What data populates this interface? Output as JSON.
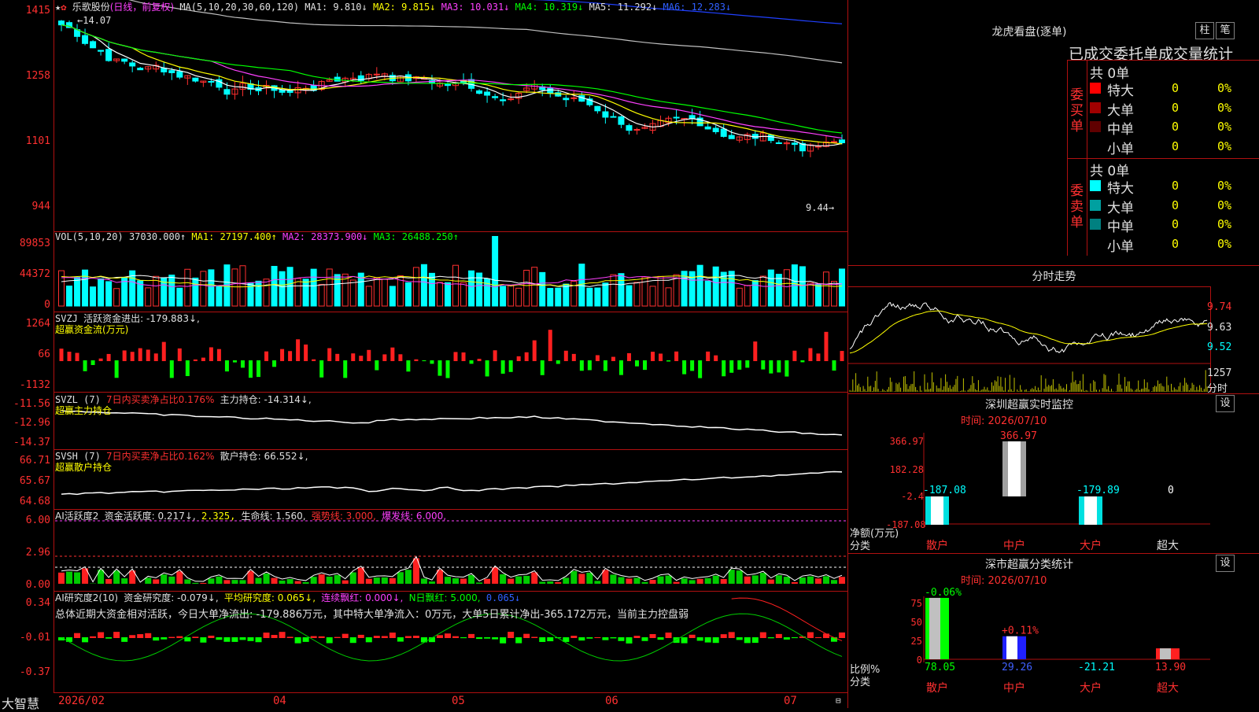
{
  "stock": {
    "name": "乐歌股份",
    "period_label": "(日线，前复权)",
    "ma_header": "MA(5,10,20,30,60,120)",
    "ma1": "MA1: 9.810↓",
    "ma2": "MA2: 9.815↓",
    "ma3": "MA3: 10.031↓",
    "ma4": "MA4: 10.319↓",
    "ma5": "MA5: 11.292↓",
    "ma6": "MA6: 12.283↓",
    "high_label": "14.07",
    "low_label": "9.44→",
    "y_ticks": [
      "1415",
      "1258",
      "1101",
      "944"
    ]
  },
  "vol": {
    "header": "VOL(5,10,20)",
    "value": "37030.000↑",
    "ma1": "MA1: 27197.400↑",
    "ma2": "MA2: 28373.900↓",
    "ma3": "MA3: 26488.250↑",
    "y_ticks": [
      "89853",
      "44372",
      "0"
    ]
  },
  "svzj": {
    "header": "SVZJ",
    "active": "活跃资金进出: -179.883↓,",
    "sub": "超赢资金流(万元)",
    "y_ticks": [
      "1264",
      "66",
      "-1132"
    ]
  },
  "svzl": {
    "header": "SVZL (7)",
    "ratio": "7日内买卖净占比0.176%",
    "pos": "主力持仓: -14.314↓,",
    "sub": "超赢主力持仓",
    "y_ticks": [
      "-11.56",
      "-12.96",
      "-14.37"
    ]
  },
  "svsh": {
    "header": "SVSH (7)",
    "ratio": "7日内买卖净占比0.162%",
    "pos": "散户持仓: 66.552↓,",
    "sub": "超赢散户持仓",
    "y_ticks": [
      "66.71",
      "65.67",
      "64.68"
    ]
  },
  "ai1": {
    "header": "AI活跃度2",
    "act": "资金活跃度: 0.217↓,",
    "v2": "2.325,",
    "life": "生命线: 1.560,",
    "strong": "强势线: 3.000,",
    "burst": "爆发线: 6.000,",
    "y_ticks": [
      "6.00",
      "2.96",
      "0.00"
    ]
  },
  "ai2": {
    "header": "AI研究度2(10)",
    "research": "资金研究度: -0.079↓,",
    "avg": "平均研究度: 0.065↓,",
    "cont": "连续飘红: 0.000↓,",
    "nday": "N日飘红: 5.000,",
    "last": "0.065↓",
    "summary": "总体近期大资金相对活跃，今日大单净流出: -179.886万元，其中特大单净流入：0万元，大单5日累计净出-365.172万元，当前主力控盘弱",
    "y_ticks": [
      "0.34",
      "-0.01",
      "-0.37"
    ]
  },
  "xaxis": {
    "brand": "大智慧",
    "labels": [
      "2026/02",
      "04",
      "05",
      "06",
      "07"
    ]
  },
  "lhb": {
    "title": "龙虎看盘(逐单)",
    "btn1": "柱",
    "btn2": "笔",
    "subtitle": "已成交委托单成交量统计",
    "buy_label": "委买单",
    "sell_label": "委卖单",
    "buy_total": "共 0单",
    "sell_total": "共 0单",
    "buy_rows": [
      {
        "name": "特大",
        "count": "0",
        "pct": "0%",
        "color": "#ff0000"
      },
      {
        "name": "大单",
        "count": "0",
        "pct": "0%",
        "color": "#a00000"
      },
      {
        "name": "中单",
        "count": "0",
        "pct": "0%",
        "color": "#600000"
      },
      {
        "name": "小单",
        "count": "0",
        "pct": "0%",
        "color": "#000000"
      }
    ],
    "sell_rows": [
      {
        "name": "特大",
        "count": "0",
        "pct": "0%",
        "color": "#00ffff"
      },
      {
        "name": "大单",
        "count": "0",
        "pct": "0%",
        "color": "#00a0a0"
      },
      {
        "name": "中单",
        "count": "0",
        "pct": "0%",
        "color": "#008080"
      },
      {
        "name": "小单",
        "count": "0",
        "pct": "0%",
        "color": "#000000"
      }
    ]
  },
  "intraday": {
    "title": "分时走势",
    "prices": [
      "9.74",
      "9.63",
      "9.52"
    ],
    "vol_label": "1257",
    "vol_unit": "分时"
  },
  "monitor": {
    "title": "深圳超赢实时监控",
    "btn": "设",
    "time": "时间: 2026/07/10",
    "y_ticks": [
      "366.97",
      "182.28",
      "-2.4",
      "-187.08"
    ],
    "ylabel1": "净额(万元)",
    "ylabel2": "分类",
    "categories": [
      "散户",
      "中户",
      "大户",
      "超大"
    ],
    "values": [
      -187.08,
      366.97,
      -179.89,
      0
    ],
    "value_labels": [
      "-187.08",
      "366.97",
      "-179.89",
      "0"
    ]
  },
  "classify": {
    "title": "深市超赢分类统计",
    "btn": "设",
    "time": "时间: 2026/07/10",
    "y_ticks": [
      "75",
      "50",
      "25",
      "0"
    ],
    "ylabel1": "比例%",
    "ylabel2": "分类",
    "categories": [
      "散户",
      "中户",
      "大户",
      "超大"
    ],
    "change_labels": [
      "-0.06%",
      "+0.11%",
      "",
      ""
    ],
    "value_labels": [
      "78.05",
      "29.26",
      "-21.21",
      "13.90"
    ],
    "values": [
      78.05,
      29.26,
      0,
      13.9
    ]
  },
  "colors": {
    "up": "#ff3030",
    "down": "#00ffff",
    "ma1": "#ffffff",
    "ma2": "#ffff00",
    "ma3": "#ff40ff",
    "ma4": "#00ff00",
    "ma5": "#c0c0c0",
    "ma6": "#2040ff",
    "grid": "#b01010"
  }
}
